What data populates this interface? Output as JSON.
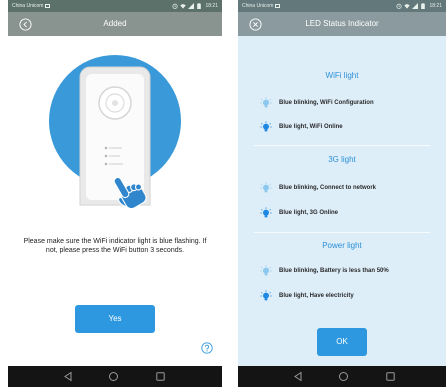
{
  "colors": {
    "accent": "#2d98e0",
    "heading": "#2b8fd6",
    "illustration_circle": "#3a9ad9",
    "panel_background": "#deeef9",
    "status_bar": "#5d716b",
    "header_bar": "#89938f",
    "nav_bar": "#141414"
  },
  "left_screen": {
    "status_bar": {
      "carrier": "China Unicom",
      "time": "18:21",
      "icons": [
        "sim-image-icon",
        "alarm-icon",
        "wifi-icon",
        "signal-icon",
        "battery-icon"
      ]
    },
    "header": {
      "title": "Added",
      "icon": "back-circle-icon"
    },
    "illustration": {
      "icons": [
        "device-icon",
        "power-button-icon",
        "led-indicators-icon",
        "pointing-hand-icon"
      ]
    },
    "message": "Please make sure the WiFi indicator light is blue flashing. If not, please press the WiFi button 3 seconds.",
    "yes_button": {
      "label": "Yes"
    },
    "help_icon": "help-icon",
    "nav_bar": {
      "icons": [
        "back-nav-icon",
        "home-nav-icon",
        "recents-nav-icon"
      ]
    }
  },
  "right_screen": {
    "status_bar": {
      "carrier": "China Unicom",
      "time": "18:21",
      "icons": [
        "sim-image-icon",
        "alarm-icon",
        "wifi-icon",
        "signal-icon",
        "battery-icon"
      ]
    },
    "header": {
      "title": "LED Status Indicator",
      "icon": "close-circle-icon"
    },
    "sections": [
      {
        "heading": "WiFi light",
        "items": [
          {
            "icon": "bulb-blinking-icon",
            "text": "Blue blinking, WiFi Configuration"
          },
          {
            "icon": "bulb-on-icon",
            "text": "Blue light, WiFi Online"
          }
        ]
      },
      {
        "heading": "3G light",
        "items": [
          {
            "icon": "bulb-blinking-icon",
            "text": "Blue blinking, Connect to network"
          },
          {
            "icon": "bulb-on-icon",
            "text": "Blue light, 3G Online"
          }
        ]
      },
      {
        "heading": "Power light",
        "items": [
          {
            "icon": "bulb-blinking-icon",
            "text": "Blue blinking, Battery is less than 50%"
          },
          {
            "icon": "bulb-on-icon",
            "text": "Blue light, Have electricity"
          }
        ]
      }
    ],
    "ok_button": {
      "label": "OK"
    },
    "nav_bar": {
      "icons": [
        "back-nav-icon",
        "home-nav-icon",
        "recents-nav-icon"
      ]
    }
  }
}
